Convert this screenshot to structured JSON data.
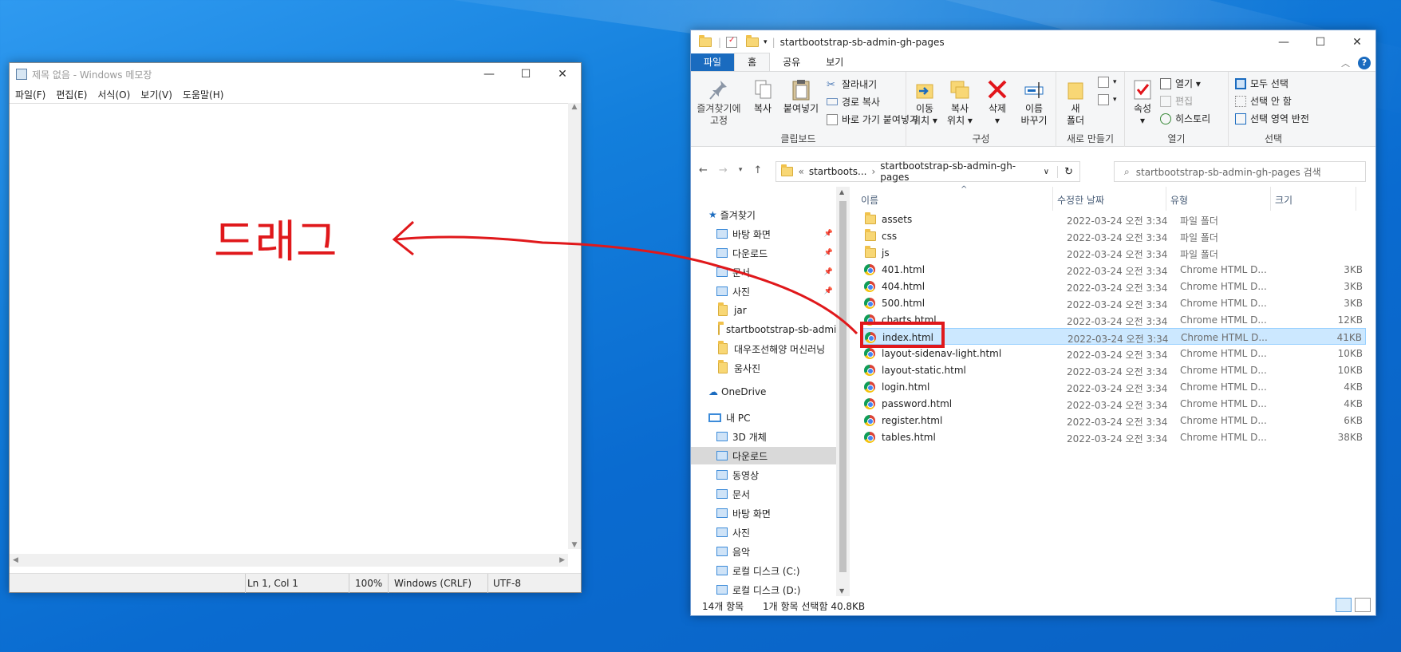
{
  "notepad": {
    "title": "제목 없음 - Windows 메모장",
    "menu": [
      "파일(F)",
      "편집(E)",
      "서식(O)",
      "보기(V)",
      "도움말(H)"
    ],
    "status": {
      "position": "Ln 1, Col 1",
      "zoom": "100%",
      "line_ending": "Windows (CRLF)",
      "encoding": "UTF-8"
    }
  },
  "window_buttons": {
    "minimize": "—",
    "maximize": "☐",
    "close": "✕"
  },
  "annotation": {
    "drag_label": "드래그",
    "color": "#e0181b"
  },
  "explorer": {
    "title": "startbootstrap-sb-admin-gh-pages",
    "tabs": [
      "파일",
      "홈",
      "공유",
      "보기"
    ],
    "help": "?",
    "ribbon": {
      "pin": "즐겨찾기에\n고정",
      "copy": "복사",
      "paste": "붙여넣기",
      "cut": "잘라내기",
      "copy_path": "경로 복사",
      "paste_shortcut": "바로 가기 붙여넣기",
      "clipboard_group": "클립보드",
      "move_to": "이동\n위치 ▾",
      "copy_to": "복사\n위치 ▾",
      "delete": "삭제\n▾",
      "rename": "이름\n바꾸기",
      "organize_group": "구성",
      "new_folder": "새\n폴더",
      "new_group": "새로 만들기",
      "properties": "속성\n▾",
      "open": "열기 ▾",
      "edit": "편집",
      "history": "히스토리",
      "open_group": "열기",
      "select_all": "모두 선택",
      "select_none": "선택 안 함",
      "invert_selection": "선택 영역 반전",
      "select_group": "선택"
    },
    "address": {
      "crumb1": "startboots...",
      "crumb2": "startbootstrap-sb-admin-gh-pages",
      "prefix": "«",
      "sep": "›"
    },
    "search_placeholder": "startbootstrap-sb-admin-gh-pages 검색",
    "nav": {
      "quick": "즐겨찾기",
      "pinned": [
        "바탕 화면",
        "다운로드",
        "문서",
        "사진"
      ],
      "folders": [
        "jar",
        "startbootstrap-sb-admin",
        "대우조선해양 머신러닝",
        "움사진"
      ],
      "onedrive": "OneDrive",
      "pc": "내 PC",
      "pc_items": [
        "3D 개체",
        "다운로드",
        "동영상",
        "문서",
        "바탕 화면",
        "사진",
        "음악",
        "로컬 디스크 (C:)",
        "로컬 디스크 (D:)"
      ]
    },
    "columns": {
      "name": "이름",
      "date": "수정한 날짜",
      "type": "유형",
      "size": "크기",
      "sort_arrow": "^"
    },
    "files": [
      {
        "name": "assets",
        "date": "2022-03-24 오전 3:34",
        "type": "파일 폴더",
        "size": "",
        "kind": "folder"
      },
      {
        "name": "css",
        "date": "2022-03-24 오전 3:34",
        "type": "파일 폴더",
        "size": "",
        "kind": "folder"
      },
      {
        "name": "js",
        "date": "2022-03-24 오전 3:34",
        "type": "파일 폴더",
        "size": "",
        "kind": "folder"
      },
      {
        "name": "401.html",
        "date": "2022-03-24 오전 3:34",
        "type": "Chrome HTML D...",
        "size": "3KB",
        "kind": "html"
      },
      {
        "name": "404.html",
        "date": "2022-03-24 오전 3:34",
        "type": "Chrome HTML D...",
        "size": "3KB",
        "kind": "html"
      },
      {
        "name": "500.html",
        "date": "2022-03-24 오전 3:34",
        "type": "Chrome HTML D...",
        "size": "3KB",
        "kind": "html"
      },
      {
        "name": "charts.html",
        "date": "2022-03-24 오전 3:34",
        "type": "Chrome HTML D...",
        "size": "12KB",
        "kind": "html"
      },
      {
        "name": "index.html",
        "date": "2022-03-24 오전 3:34",
        "type": "Chrome HTML D...",
        "size": "41KB",
        "kind": "html",
        "selected": true
      },
      {
        "name": "layout-sidenav-light.html",
        "date": "2022-03-24 오전 3:34",
        "type": "Chrome HTML D...",
        "size": "10KB",
        "kind": "html"
      },
      {
        "name": "layout-static.html",
        "date": "2022-03-24 오전 3:34",
        "type": "Chrome HTML D...",
        "size": "10KB",
        "kind": "html"
      },
      {
        "name": "login.html",
        "date": "2022-03-24 오전 3:34",
        "type": "Chrome HTML D...",
        "size": "4KB",
        "kind": "html"
      },
      {
        "name": "password.html",
        "date": "2022-03-24 오전 3:34",
        "type": "Chrome HTML D...",
        "size": "4KB",
        "kind": "html"
      },
      {
        "name": "register.html",
        "date": "2022-03-24 오전 3:34",
        "type": "Chrome HTML D...",
        "size": "6KB",
        "kind": "html"
      },
      {
        "name": "tables.html",
        "date": "2022-03-24 오전 3:34",
        "type": "Chrome HTML D...",
        "size": "38KB",
        "kind": "html"
      }
    ],
    "status": {
      "count": "14개 항목",
      "selection": "1개 항목 선택함 40.8KB"
    }
  }
}
